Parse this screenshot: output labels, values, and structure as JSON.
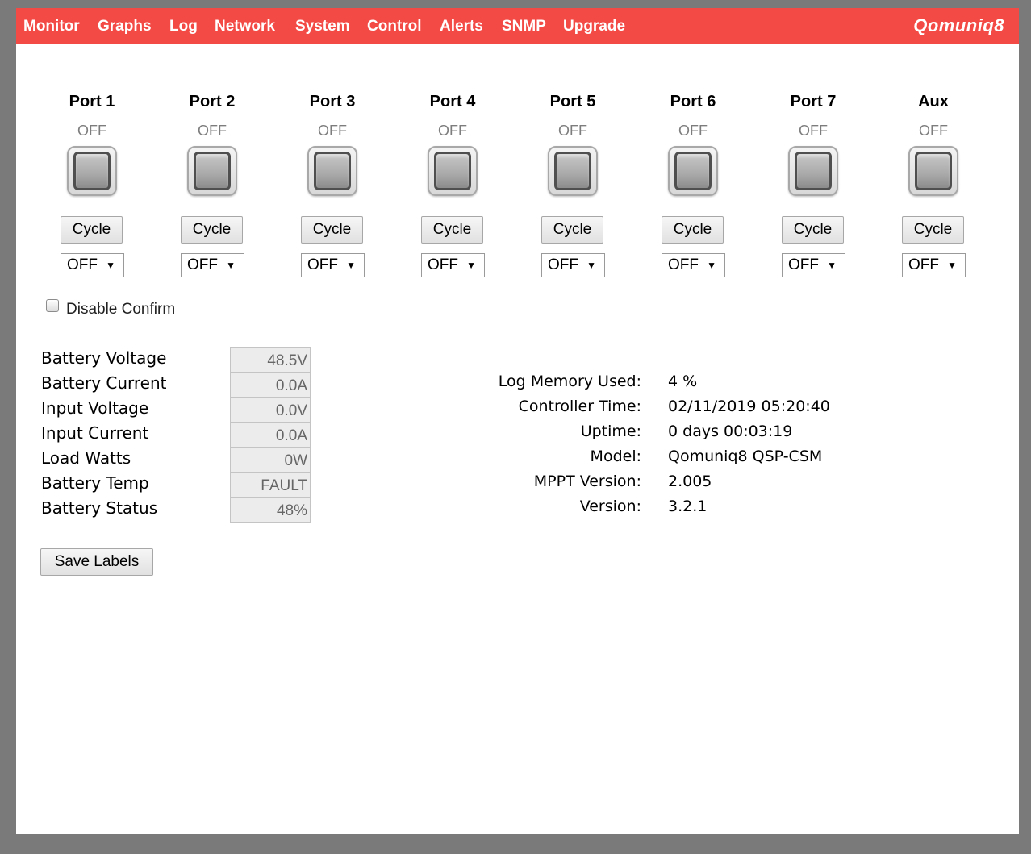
{
  "nav": {
    "items": [
      "Monitor",
      "Graphs",
      "Log",
      "Network",
      "System",
      "Control",
      "Alerts",
      "SNMP",
      "Upgrade"
    ],
    "brand": "Qomuniq8"
  },
  "ports": [
    {
      "name": "Port 1",
      "state": "OFF",
      "cycle_label": "Cycle",
      "mode": "OFF"
    },
    {
      "name": "Port 2",
      "state": "OFF",
      "cycle_label": "Cycle",
      "mode": "OFF"
    },
    {
      "name": "Port 3",
      "state": "OFF",
      "cycle_label": "Cycle",
      "mode": "OFF"
    },
    {
      "name": "Port 4",
      "state": "OFF",
      "cycle_label": "Cycle",
      "mode": "OFF"
    },
    {
      "name": "Port 5",
      "state": "OFF",
      "cycle_label": "Cycle",
      "mode": "OFF"
    },
    {
      "name": "Port 6",
      "state": "OFF",
      "cycle_label": "Cycle",
      "mode": "OFF"
    },
    {
      "name": "Port 7",
      "state": "OFF",
      "cycle_label": "Cycle",
      "mode": "OFF"
    },
    {
      "name": "Aux",
      "state": "OFF",
      "cycle_label": "Cycle",
      "mode": "OFF"
    }
  ],
  "disable_confirm": {
    "label": "Disable Confirm",
    "checked": false
  },
  "stats": [
    {
      "label": "Battery Voltage",
      "value": "48.5V"
    },
    {
      "label": "Battery Current",
      "value": "0.0A"
    },
    {
      "label": "Input Voltage",
      "value": "0.0V"
    },
    {
      "label": "Input Current",
      "value": "0.0A"
    },
    {
      "label": "Load Watts",
      "value": "0W"
    },
    {
      "label": "Battery Temp",
      "value": "FAULT"
    },
    {
      "label": "Battery Status",
      "value": "48%"
    }
  ],
  "info": [
    {
      "label": "Log Memory Used:",
      "value": "4 %"
    },
    {
      "label": "Controller Time:",
      "value": "02/11/2019 05:20:40"
    },
    {
      "label": "Uptime:",
      "value": "0 days 00:03:19"
    },
    {
      "label": "Model:",
      "value": "Qomuniq8 QSP-CSM"
    },
    {
      "label": "MPPT Version:",
      "value": "2.005"
    },
    {
      "label": "Version:",
      "value": "3.2.1"
    }
  ],
  "save_labels_label": "Save Labels",
  "colors": {
    "navbar": "#f34a45",
    "frame": "#7a7a7a",
    "nav_text": "#ffffff"
  }
}
